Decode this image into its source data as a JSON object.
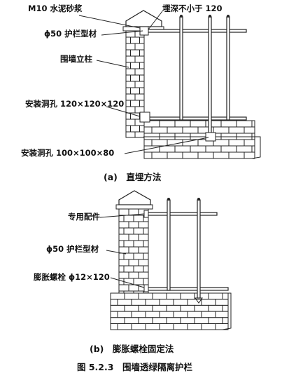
{
  "diagram_a": {
    "labels": {
      "mortar": "M10 水泥砂浆",
      "embed_depth": "埋深不小于 120",
      "rail_profile": "ϕ50 护栏型材",
      "wall_column": "围墙立柱",
      "hole_upper": "安装洞孔 120×120×120",
      "hole_lower": "安装洞孔 100×100×80"
    },
    "caption": "(a)　直埋方法"
  },
  "diagram_b": {
    "labels": {
      "fitting": "专用配件",
      "rail_profile": "ϕ50 护栏型材",
      "expansion_bolt": "膨胀螺栓 ϕ12×120"
    },
    "caption": "(b)　膨胀螺栓固定法"
  },
  "figure_title": "图 5.2.3　围墙透绿隔离护栏"
}
